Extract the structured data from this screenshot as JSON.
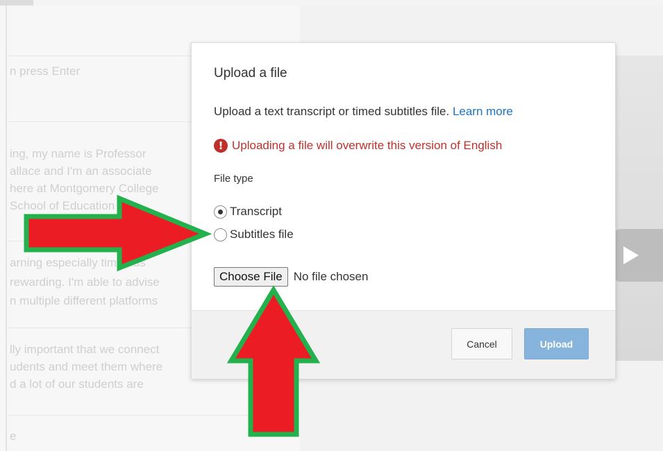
{
  "background": {
    "search_placeholder": "n press Enter",
    "segments": [
      [
        "ing, my name is Professor",
        "allace and I'm an associate",
        "here at Montgomery College",
        "School of Education"
      ],
      [
        "arning especially time has",
        "rewarding. I'm able to advise",
        "n multiple different platforms"
      ],
      [
        "lly important that we connect",
        "udents and meet them where",
        "d a lot of our students are"
      ],
      [
        "e"
      ]
    ]
  },
  "dialog": {
    "title": "Upload a file",
    "description": "Upload a text transcript or timed subtitles file.",
    "learn_more": "Learn more",
    "warning": "Uploading a file will overwrite this version of English",
    "warning_icon": "!",
    "file_type_label": "File type",
    "options": [
      {
        "label": "Transcript",
        "selected": true
      },
      {
        "label": "Subtitles file",
        "selected": false
      }
    ],
    "choose_file_label": "Choose File",
    "no_file_text": "No file chosen",
    "cancel_label": "Cancel",
    "upload_label": "Upload"
  },
  "colors": {
    "warning": "#c0302b",
    "link": "#1a73c8",
    "upload_button": "#86b4dc",
    "arrow_fill": "#ec1c24",
    "arrow_stroke": "#22b14c"
  },
  "icons": {
    "warning": "exclamation-circle-icon",
    "play": "play-icon"
  }
}
